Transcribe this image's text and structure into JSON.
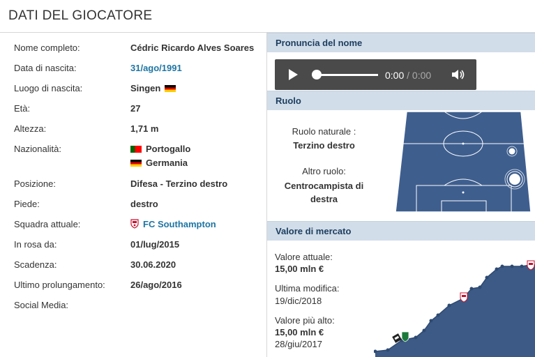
{
  "header": {
    "title": "DATI DEL GIOCATORE"
  },
  "details": {
    "full_name_label": "Nome completo:",
    "full_name": "Cédric Ricardo Alves Soares",
    "birth_date_label": "Data di nascita:",
    "birth_date": "31/ago/1991",
    "birth_place_label": "Luogo di nascita:",
    "birth_place": "Singen",
    "age_label": "Età:",
    "age": "27",
    "height_label": "Altezza:",
    "height": "1,71 m",
    "nationality_label": "Nazionalità:",
    "nationalities": [
      "Portogallo",
      "Germania"
    ],
    "position_label": "Posizione:",
    "position": "Difesa - Terzino destro",
    "foot_label": "Piede:",
    "foot": "destro",
    "club_label": "Squadra attuale:",
    "club": "FC Southampton",
    "joined_label": "In rosa da:",
    "joined": "01/lug/2015",
    "contract_label": "Scadenza:",
    "contract": "30.06.2020",
    "extension_label": "Ultimo prolungamento:",
    "extension": "26/ago/2016",
    "social_label": "Social Media:"
  },
  "pronunciation": {
    "heading": "Pronuncia del nome",
    "current_time": "0:00",
    "separator": "/",
    "total_time": "0:00",
    "progress": 0,
    "icons": [
      "play-icon",
      "volume-icon"
    ]
  },
  "role": {
    "heading": "Ruolo",
    "natural_label": "Ruolo naturale :",
    "natural_value": "Terzino destro",
    "other_label": "Altro ruolo:",
    "other_value_line1": "Centrocampista di",
    "other_value_line2": "destra"
  },
  "market": {
    "heading": "Valore di mercato",
    "current_label": "Valore attuale:",
    "current_value": "15,00 mln €",
    "last_change_label": "Ultima modifica:",
    "last_change": "19/dic/2018",
    "highest_label": "Valore più alto:",
    "highest_value": "15,00 mln €",
    "highest_date": "28/giu/2017"
  },
  "colors": {
    "link": "#1d75a3",
    "section_header_bg": "#d1dde9",
    "pitch": "#3e5e8e",
    "chart_fill": "#3c5a85"
  }
}
